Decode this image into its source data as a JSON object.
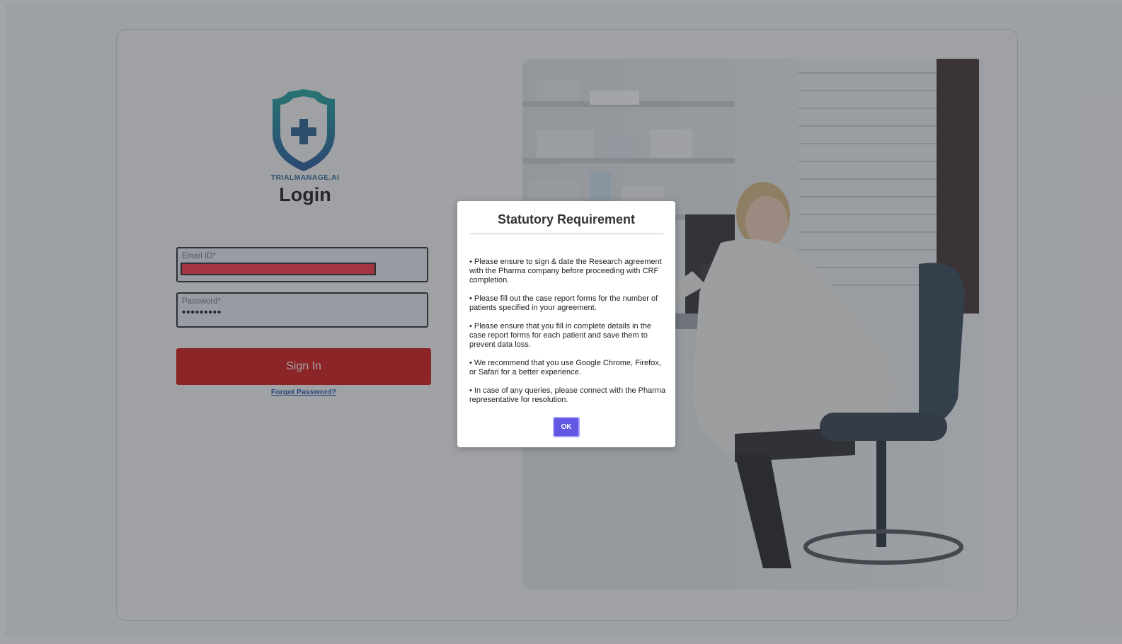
{
  "brand": {
    "name": "TRIALMANAGE.AI"
  },
  "login": {
    "title": "Login",
    "email_label": "Email ID*",
    "password_label": "Password*",
    "password_value": "•••••••••",
    "signin_label": "Sign In",
    "forgot_label": "Forgot Password?"
  },
  "dialog": {
    "title": "Statutory Requirement",
    "items": [
      "• Please ensure to sign & date the Research agreement with the Pharma company before proceeding with CRF completion.",
      "• Please fill out the case report forms for the number of patients specified in your agreement.",
      "• Please ensure that you fill in complete details in the case report forms for each patient and save them to prevent data loss.",
      "• We recommend that you use Google Chrome, Firefox, or Safari for a better experience.",
      "• In case of any queries, please connect with the Pharma representative for resolution."
    ],
    "ok_label": "OK"
  },
  "colors": {
    "signin_bg": "#d40e0e",
    "ok_bg": "#6257e2",
    "email_redaction": "#ff2a3f"
  },
  "icons": {
    "logo": "shield-plus-icon"
  }
}
